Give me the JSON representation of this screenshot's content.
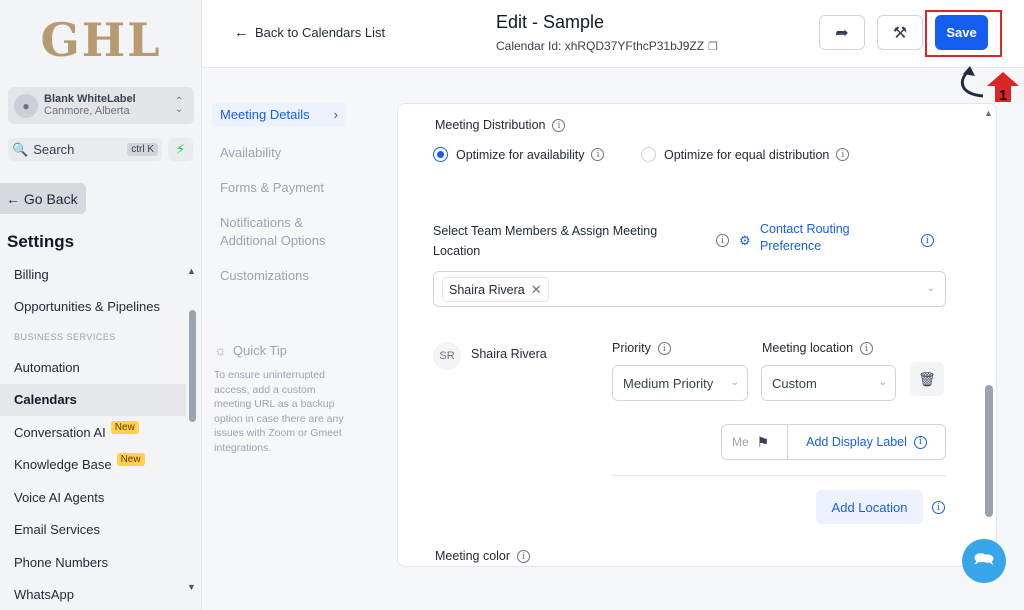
{
  "brand": {
    "logo_text": "GHL"
  },
  "account": {
    "name": "Blank WhiteLabel",
    "location": "Canmore, Alberta"
  },
  "search": {
    "label": "Search",
    "shortcut": "ctrl K"
  },
  "sidebar": {
    "go_back": "Go Back",
    "settings_heading": "Settings",
    "items": [
      {
        "label": "Billing"
      },
      {
        "label": "Opportunities & Pipelines"
      },
      {
        "label": "BUSINESS SERVICES"
      },
      {
        "label": "Automation"
      },
      {
        "label": "Calendars"
      },
      {
        "label": "Conversation AI",
        "badge": "New"
      },
      {
        "label": "Knowledge Base",
        "badge": "New"
      },
      {
        "label": "Voice AI Agents"
      },
      {
        "label": "Email Services"
      },
      {
        "label": "Phone Numbers"
      },
      {
        "label": "WhatsApp"
      }
    ]
  },
  "header": {
    "back_label": "Back to Calendars List",
    "title": "Edit - Sample",
    "calendar_id": "Calendar Id: xhRQD37YFthcP31bJ9ZZ",
    "save_label": "Save"
  },
  "marker": {
    "number": "1"
  },
  "steps": [
    {
      "label": "Meeting Details"
    },
    {
      "label": "Availability"
    },
    {
      "label": "Forms & Payment"
    },
    {
      "label": "Notifications & Additional Options"
    },
    {
      "label": "Customizations"
    }
  ],
  "tip": {
    "title": "Quick Tip",
    "body": "To ensure uninterrupted access, add a custom meeting URL as a backup option in case there are any issues with Zoom or Gmeet integrations."
  },
  "form": {
    "distribution_label": "Meeting Distribution",
    "option_availability": "Optimize for availability",
    "option_equal": "Optimize for equal distribution",
    "team_label": "Select Team Members & Assign Meeting Location",
    "routing_link": "Contact Routing Preference",
    "selected_member": "Shaira Rivera",
    "member_initials": "SR",
    "member_name": "Shaira Rivera",
    "priority_label": "Priority",
    "priority_value": "Medium Priority",
    "location_label": "Meeting location",
    "location_value": "Custom",
    "mini_input": "Me",
    "display_label_btn": "Add Display Label",
    "add_location": "Add Location",
    "color_label": "Meeting color"
  }
}
